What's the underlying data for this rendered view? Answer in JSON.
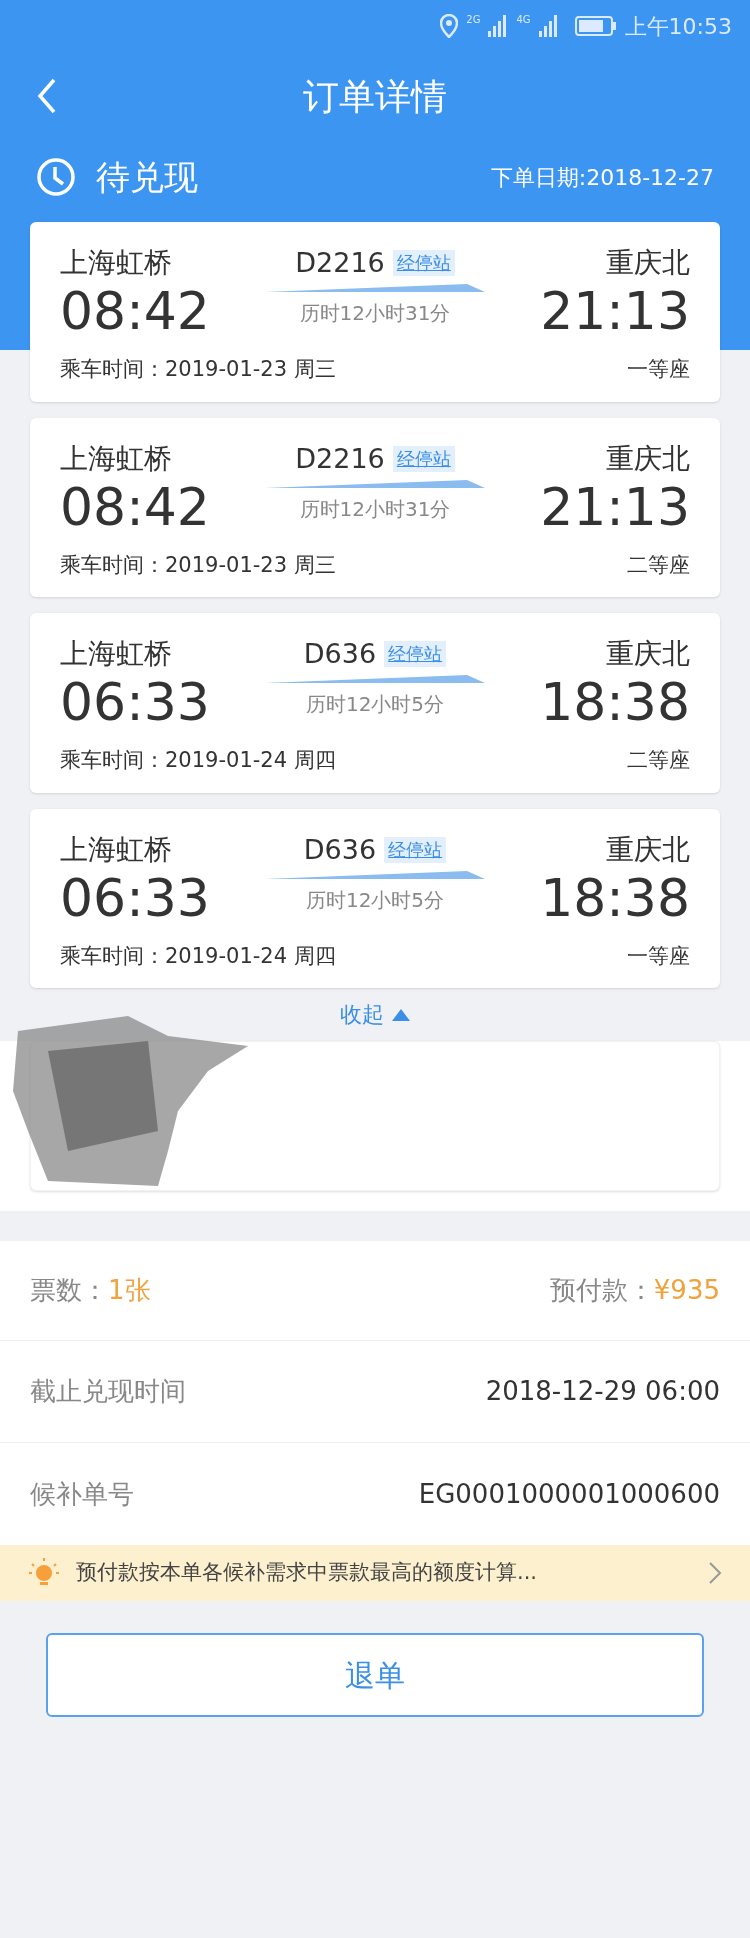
{
  "status_bar": {
    "network_1": "2G",
    "network_2": "4G",
    "time": "上午10:53"
  },
  "header": {
    "title": "订单详情"
  },
  "order_status": {
    "label": "待兑现",
    "order_date": "下单日期:2018-12-27"
  },
  "trips": [
    {
      "from": "上海虹桥",
      "depart": "08:42",
      "train": "D2216",
      "stops_link": "经停站",
      "duration": "历时12小时31分",
      "to": "重庆北",
      "arrive": "21:13",
      "ride_date": "乘车时间：2019-01-23 周三",
      "seat": "一等座"
    },
    {
      "from": "上海虹桥",
      "depart": "08:42",
      "train": "D2216",
      "stops_link": "经停站",
      "duration": "历时12小时31分",
      "to": "重庆北",
      "arrive": "21:13",
      "ride_date": "乘车时间：2019-01-23 周三",
      "seat": "二等座"
    },
    {
      "from": "上海虹桥",
      "depart": "06:33",
      "train": "D636",
      "stops_link": "经停站",
      "duration": "历时12小时5分",
      "to": "重庆北",
      "arrive": "18:38",
      "ride_date": "乘车时间：2019-01-24 周四",
      "seat": "二等座"
    },
    {
      "from": "上海虹桥",
      "depart": "06:33",
      "train": "D636",
      "stops_link": "经停站",
      "duration": "历时12小时5分",
      "to": "重庆北",
      "arrive": "18:38",
      "ride_date": "乘车时间：2019-01-24 周四",
      "seat": "一等座"
    }
  ],
  "collapse_link": {
    "label": "收起",
    "expanded": true
  },
  "summary": {
    "tickets_label": "票数：",
    "tickets_value": "1张",
    "prepay_label": "预付款：",
    "prepay_value": "¥935"
  },
  "details": [
    {
      "label": "截止兑现时间",
      "value": "2018-12-29 06:00"
    },
    {
      "label": "候补单号",
      "value": "EG0001000001000600"
    }
  ],
  "notice": "预付款按本单各候补需求中票款最高的额度计算...",
  "refund_button": "退单"
}
